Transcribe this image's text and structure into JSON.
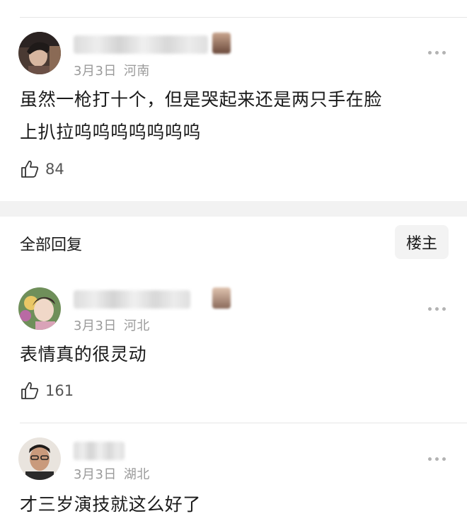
{
  "main_comment": {
    "date": "3月3日",
    "location": "河南",
    "text_line1": "虽然一枪打十个，但是哭起来还是两只手在脸",
    "text_line2": "上扒拉呜呜呜呜呜呜呜",
    "likes": "84"
  },
  "replies_header": {
    "title": "全部回复",
    "owner_button": "楼主"
  },
  "replies": [
    {
      "date": "3月3日",
      "location": "河北",
      "text": "表情真的很灵动",
      "likes": "161"
    },
    {
      "date": "3月3日",
      "location": "湖北",
      "text": "才三岁演技就这么好了"
    }
  ],
  "colors": {
    "meta_gray": "#9a9a9a",
    "band": "#f2f2f2",
    "text": "#1a1a1a"
  },
  "icons": {
    "like": "thumbs-up-icon",
    "more": "more-dots-icon"
  }
}
